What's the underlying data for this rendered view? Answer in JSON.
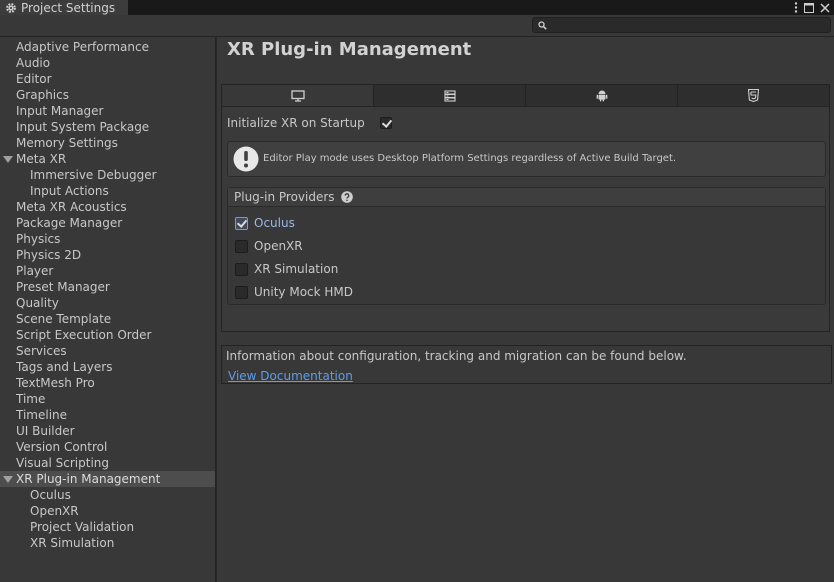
{
  "window": {
    "tab_title": "Project Settings"
  },
  "search": {
    "value": "",
    "placeholder": ""
  },
  "sidebar": {
    "items": [
      {
        "label": "Adaptive Performance",
        "level": 0
      },
      {
        "label": "Audio",
        "level": 0
      },
      {
        "label": "Editor",
        "level": 0
      },
      {
        "label": "Graphics",
        "level": 0
      },
      {
        "label": "Input Manager",
        "level": 0
      },
      {
        "label": "Input System Package",
        "level": 0
      },
      {
        "label": "Memory Settings",
        "level": 0
      },
      {
        "label": "Meta XR",
        "level": 0,
        "expanded": true
      },
      {
        "label": "Immersive Debugger",
        "level": 1
      },
      {
        "label": "Input Actions",
        "level": 1
      },
      {
        "label": "Meta XR Acoustics",
        "level": 0
      },
      {
        "label": "Package Manager",
        "level": 0
      },
      {
        "label": "Physics",
        "level": 0
      },
      {
        "label": "Physics 2D",
        "level": 0
      },
      {
        "label": "Player",
        "level": 0
      },
      {
        "label": "Preset Manager",
        "level": 0
      },
      {
        "label": "Quality",
        "level": 0
      },
      {
        "label": "Scene Template",
        "level": 0
      },
      {
        "label": "Script Execution Order",
        "level": 0
      },
      {
        "label": "Services",
        "level": 0
      },
      {
        "label": "Tags and Layers",
        "level": 0
      },
      {
        "label": "TextMesh Pro",
        "level": 0
      },
      {
        "label": "Time",
        "level": 0
      },
      {
        "label": "Timeline",
        "level": 0
      },
      {
        "label": "UI Builder",
        "level": 0
      },
      {
        "label": "Version Control",
        "level": 0
      },
      {
        "label": "Visual Scripting",
        "level": 0
      },
      {
        "label": "XR Plug-in Management",
        "level": 0,
        "expanded": true,
        "selected": true
      },
      {
        "label": "Oculus",
        "level": 1
      },
      {
        "label": "OpenXR",
        "level": 1
      },
      {
        "label": "Project Validation",
        "level": 1
      },
      {
        "label": "XR Simulation",
        "level": 1
      }
    ]
  },
  "main": {
    "title": "XR Plug-in Management",
    "platform_tabs": [
      {
        "icon": "desktop-icon",
        "active": true
      },
      {
        "icon": "server-icon",
        "active": false
      },
      {
        "icon": "android-icon",
        "active": false
      },
      {
        "icon": "html5-icon",
        "active": false
      }
    ],
    "init_xr_label": "Initialize XR on Startup",
    "init_xr_checked": true,
    "help_message": "Editor Play mode uses Desktop Platform Settings regardless of Active Build Target.",
    "providers_label": "Plug-in Providers",
    "providers": [
      {
        "name": "Oculus",
        "checked": true
      },
      {
        "name": "OpenXR",
        "checked": false
      },
      {
        "name": "XR Simulation",
        "checked": false
      },
      {
        "name": "Unity Mock HMD",
        "checked": false
      }
    ],
    "info_text": "Information about configuration, tracking and migration can be found below.",
    "doc_link": "View Documentation"
  },
  "colors": {
    "link": "#5c9ee8",
    "selected_row": "#4d4d4d",
    "panel_bg": "#383838",
    "checked_provider_text": "#9cb8e6"
  }
}
